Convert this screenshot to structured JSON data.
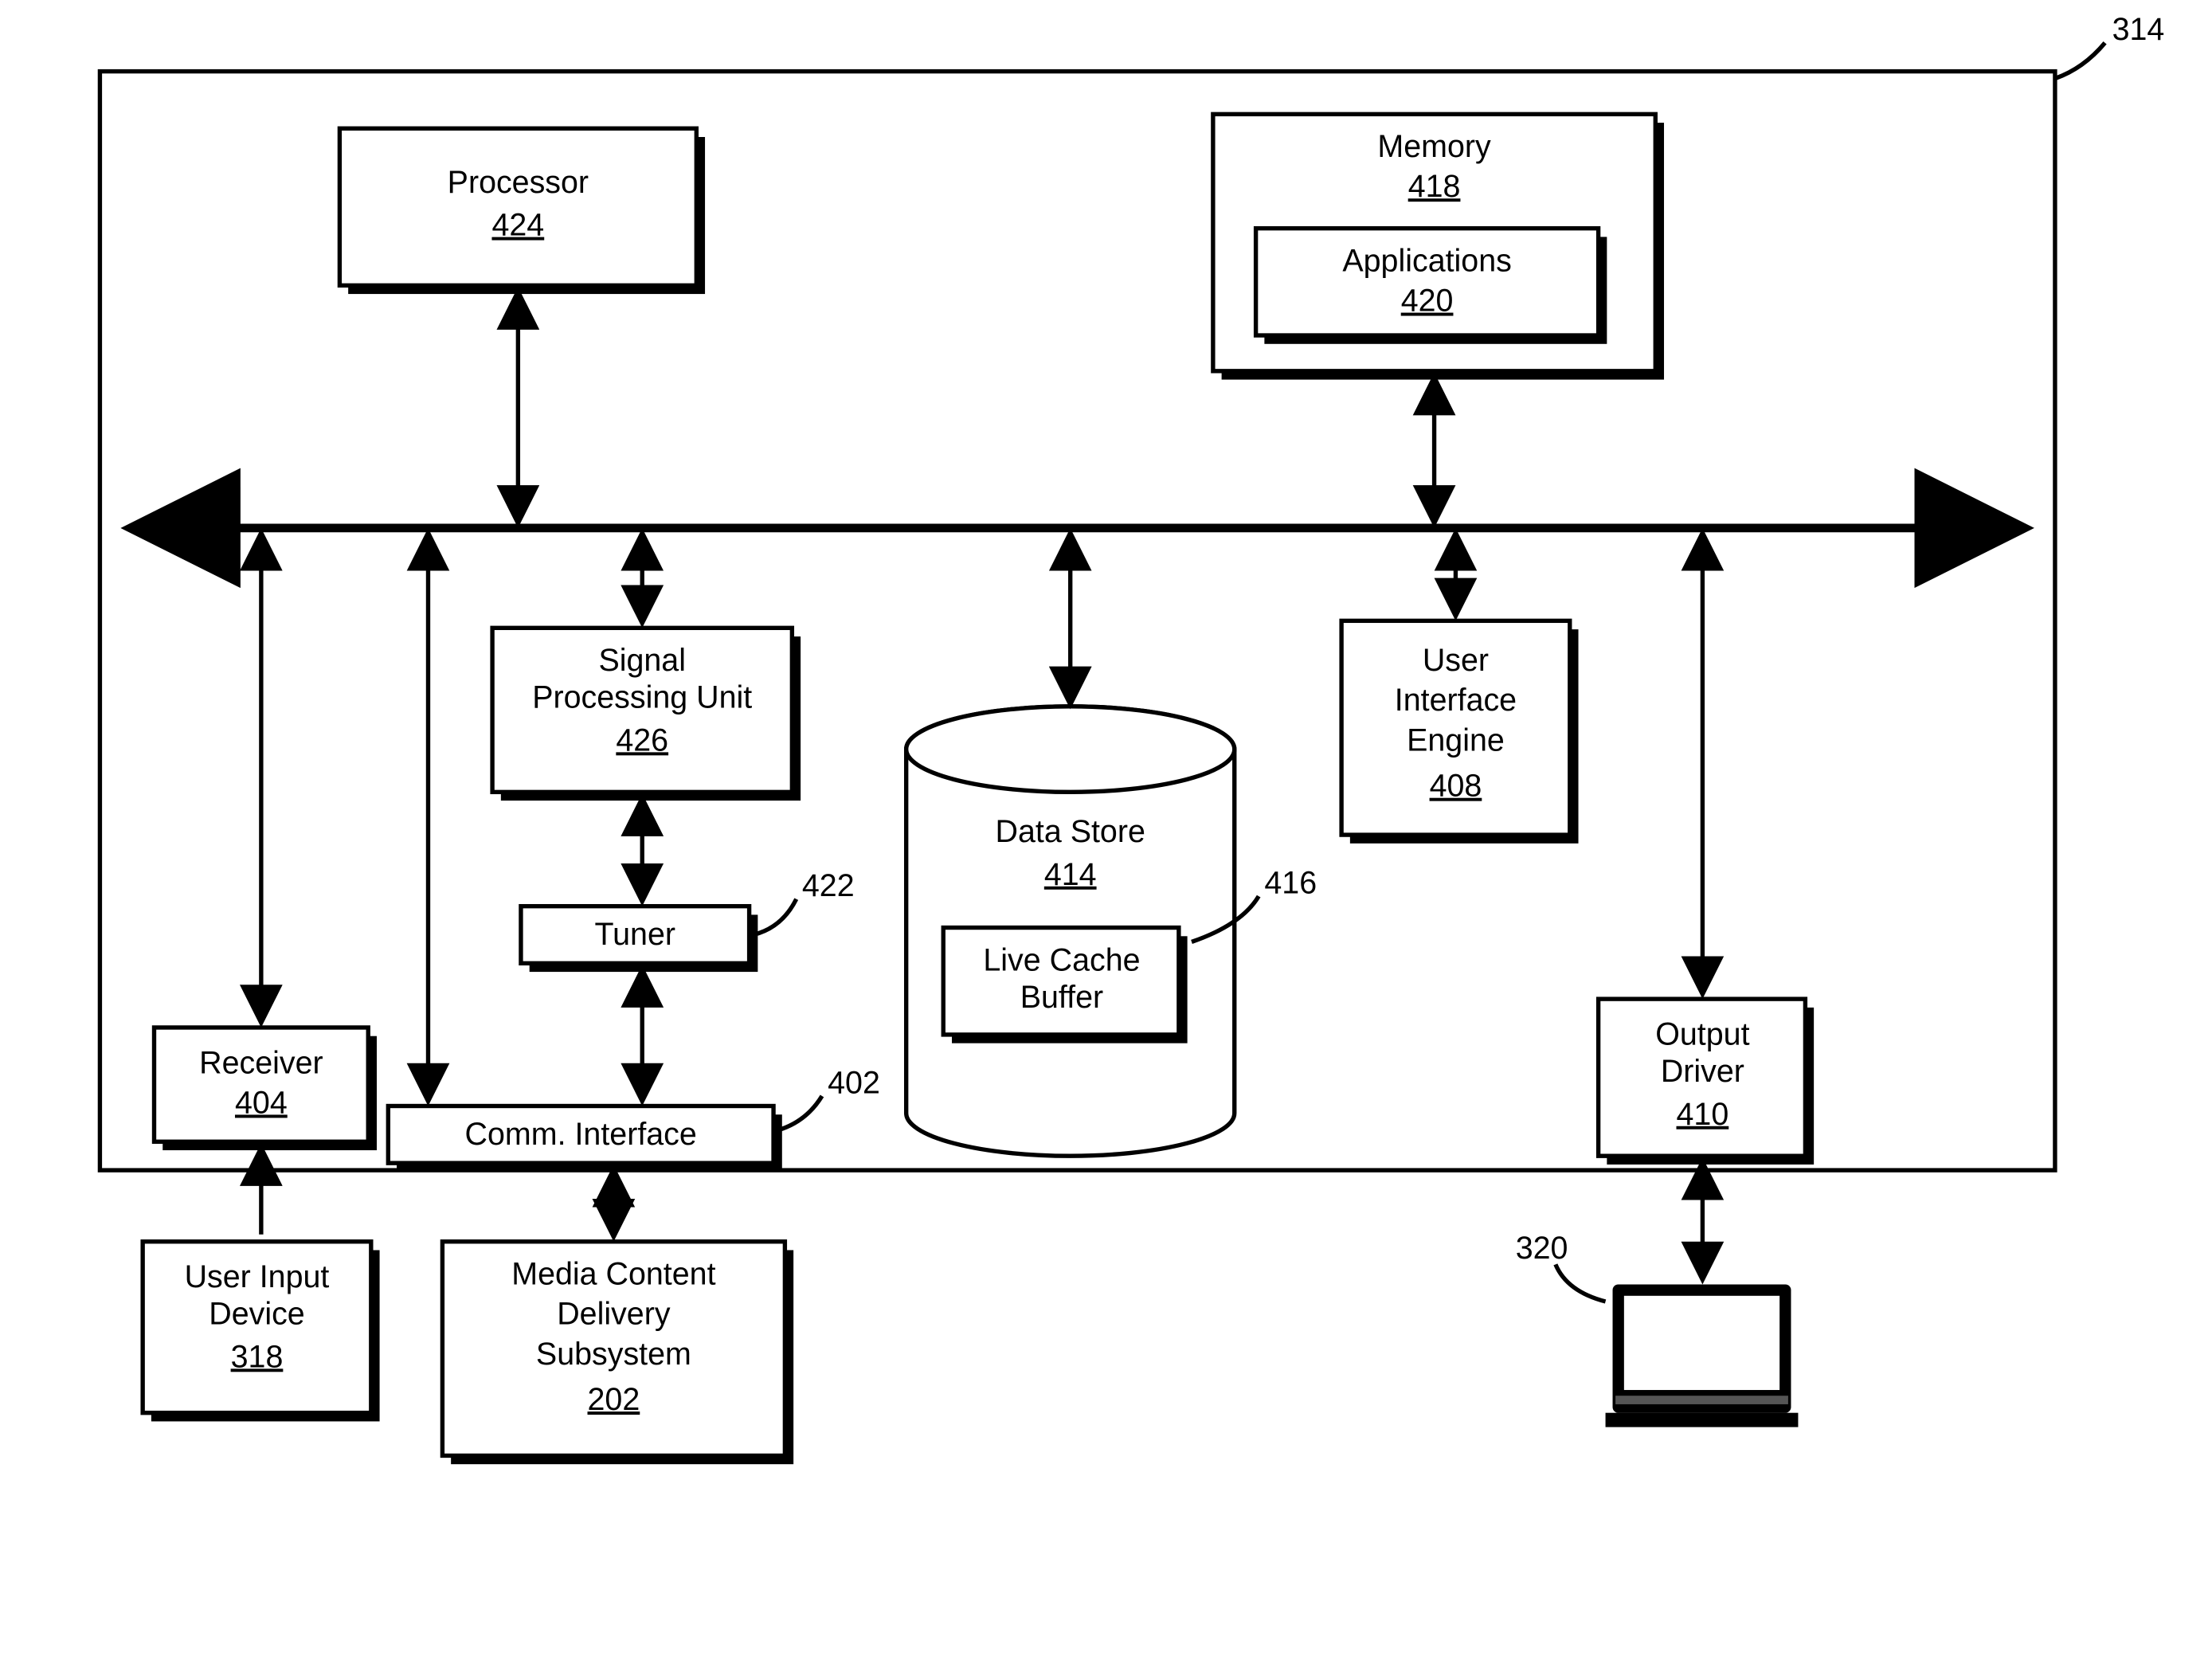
{
  "figure_ref": "314",
  "monitor_ref": "320",
  "blocks": {
    "processor": {
      "label": "Processor",
      "ref": "424"
    },
    "memory": {
      "label": "Memory",
      "ref": "418"
    },
    "applications": {
      "label": "Applications",
      "ref": "420"
    },
    "spu": {
      "label": "Signal Processing Unit",
      "ref": "426"
    },
    "tuner": {
      "label": "Tuner",
      "ref": "422"
    },
    "comm": {
      "label": "Comm. Interface",
      "ref": "402"
    },
    "datastore": {
      "label": "Data Store",
      "ref": "414"
    },
    "livecache": {
      "label": "Live Cache Buffer",
      "ref": "416"
    },
    "uie": {
      "label": "User Interface Engine",
      "ref": "408"
    },
    "output": {
      "label": "Output Driver",
      "ref": "410"
    },
    "receiver": {
      "label": "Receiver",
      "ref": "404"
    },
    "uid": {
      "label": "User Input Device",
      "ref": "318"
    },
    "mcds": {
      "label": "Media Content Delivery Subsystem",
      "ref": "202"
    }
  }
}
